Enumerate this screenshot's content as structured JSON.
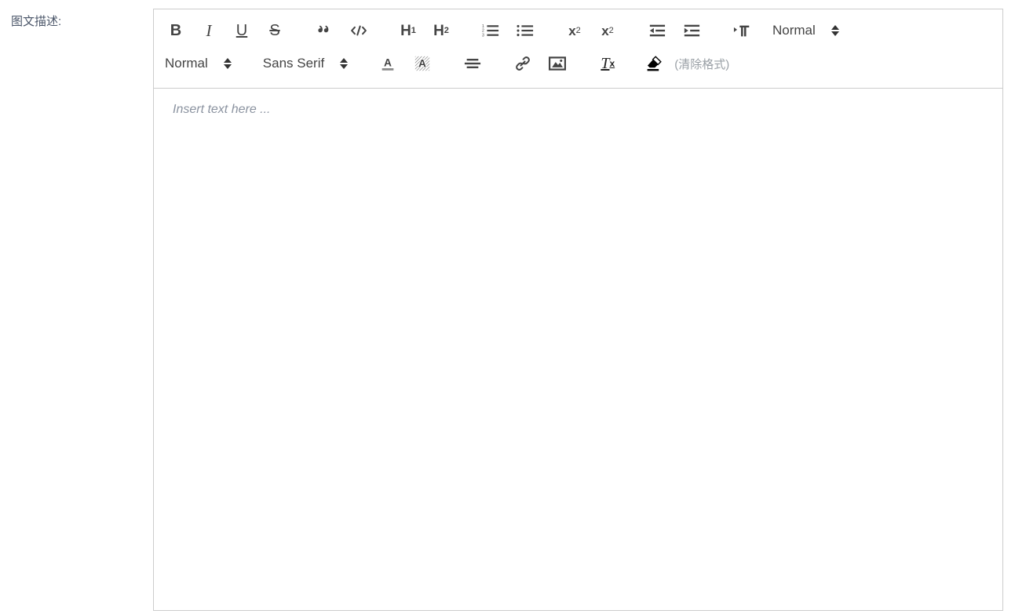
{
  "form": {
    "label": "图文描述:"
  },
  "editor": {
    "placeholder": "Insert text here ...",
    "content": ""
  },
  "toolbar": {
    "row1": {
      "bold": "B",
      "italic": "I",
      "underline": "U",
      "strike": "S",
      "blockquote": "blockquote-icon",
      "code_block": "code-block-icon",
      "header1_text": "H",
      "header1_sub": "1",
      "header2_text": "H",
      "header2_sub": "2",
      "ordered_list": "ordered-list-icon",
      "bullet_list": "bullet-list-icon",
      "subscript_text": "x",
      "subscript_sub": "2",
      "superscript_text": "x",
      "superscript_sup": "2",
      "outdent": "outdent-icon",
      "indent": "indent-icon",
      "direction": "text-direction-icon",
      "align_select": "Normal"
    },
    "row2": {
      "size_select": "Normal",
      "font_select": "Sans Serif",
      "font_color": "font-color-icon",
      "background_color": "background-color-icon",
      "align": "align-left-icon",
      "link": "link-icon",
      "image": "image-icon",
      "remove_format_text": "T",
      "remove_format_sub": "x",
      "eraser": "eraser-icon",
      "clear_format_hint": "(清除格式)"
    }
  },
  "colors": {
    "icon": "#444444",
    "border": "#cccccc",
    "placeholder": "#8b93a0",
    "hint": "#9aa0a6",
    "label": "#4a5568"
  }
}
